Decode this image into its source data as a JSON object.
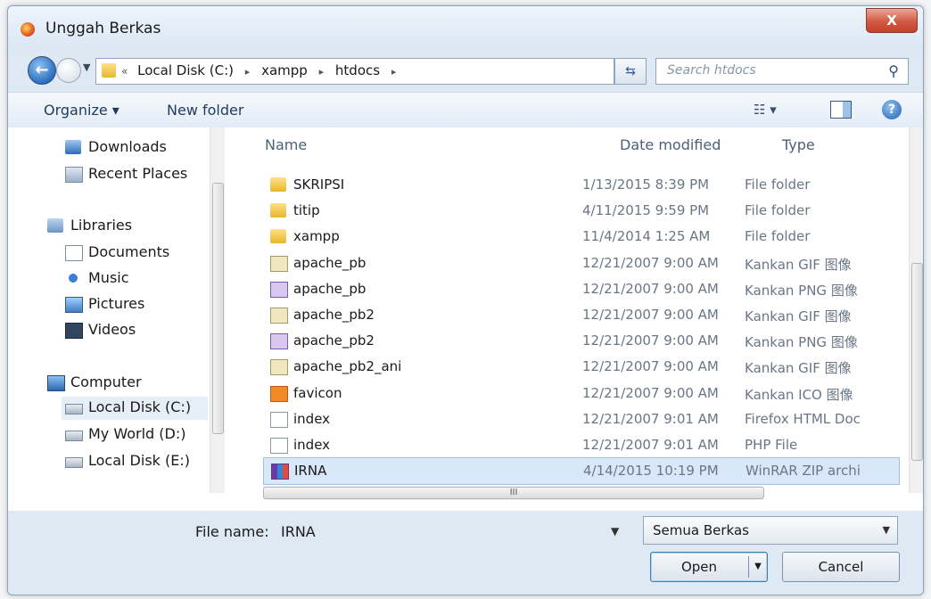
{
  "window": {
    "title": "Unggah Berkas",
    "close_label": "X"
  },
  "navigation": {
    "breadcrumbs": [
      "Local Disk (C:)",
      "xampp",
      "htdocs"
    ],
    "search_placeholder": "Search htdocs"
  },
  "toolbar": {
    "organize_label": "Organize ▾",
    "new_folder_label": "New folder",
    "views_label": "☷ ▾",
    "help_label": "?"
  },
  "sidebar": {
    "items": [
      {
        "label": "Downloads",
        "icon": "downloads-icon"
      },
      {
        "label": "Recent Places",
        "icon": "recent-places-icon"
      },
      {
        "label": "Libraries",
        "icon": "libraries-icon"
      },
      {
        "label": "Documents",
        "icon": "documents-icon"
      },
      {
        "label": "Music",
        "icon": "music-icon"
      },
      {
        "label": "Pictures",
        "icon": "pictures-icon"
      },
      {
        "label": "Videos",
        "icon": "videos-icon"
      },
      {
        "label": "Computer",
        "icon": "computer-icon"
      },
      {
        "label": "Local Disk (C:)",
        "icon": "disk-icon"
      },
      {
        "label": "My World (D:)",
        "icon": "disk-icon"
      },
      {
        "label": "Local Disk (E:)",
        "icon": "disk-icon"
      }
    ]
  },
  "files": {
    "columns": {
      "name": "Name",
      "date": "Date modified",
      "type": "Type"
    },
    "rows": [
      {
        "name": "SKRIPSI",
        "date": "1/13/2015 8:39 PM",
        "type": "File folder",
        "icon": "folder-icon"
      },
      {
        "name": "titip",
        "date": "4/11/2015 9:59 PM",
        "type": "File folder",
        "icon": "folder-icon"
      },
      {
        "name": "xampp",
        "date": "11/4/2014 1:25 AM",
        "type": "File folder",
        "icon": "folder-icon"
      },
      {
        "name": "apache_pb",
        "date": "12/21/2007 9:00 AM",
        "type": "Kankan GIF 图像",
        "icon": "gif-file-icon"
      },
      {
        "name": "apache_pb",
        "date": "12/21/2007 9:00 AM",
        "type": "Kankan PNG 图像",
        "icon": "png-file-icon"
      },
      {
        "name": "apache_pb2",
        "date": "12/21/2007 9:00 AM",
        "type": "Kankan GIF 图像",
        "icon": "gif-file-icon"
      },
      {
        "name": "apache_pb2",
        "date": "12/21/2007 9:00 AM",
        "type": "Kankan PNG 图像",
        "icon": "png-file-icon"
      },
      {
        "name": "apache_pb2_ani",
        "date": "12/21/2007 9:00 AM",
        "type": "Kankan GIF 图像",
        "icon": "gif-file-icon"
      },
      {
        "name": "favicon",
        "date": "12/21/2007 9:00 AM",
        "type": "Kankan ICO 图像",
        "icon": "ico-file-icon"
      },
      {
        "name": "index",
        "date": "12/21/2007 9:01 AM",
        "type": "Firefox HTML Doc",
        "icon": "html-file-icon"
      },
      {
        "name": "index",
        "date": "12/21/2007 9:01 AM",
        "type": "PHP File",
        "icon": "php-file-icon"
      },
      {
        "name": "IRNA",
        "date": "4/14/2015 10:19 PM",
        "type": "WinRAR ZIP archi",
        "icon": "zip-file-icon"
      }
    ],
    "hscroll_label": "III"
  },
  "footer": {
    "file_name_label": "File name:",
    "file_name_value": "IRNA",
    "file_type_value": "Semua Berkas",
    "open_label": "Open",
    "cancel_label": "Cancel"
  }
}
